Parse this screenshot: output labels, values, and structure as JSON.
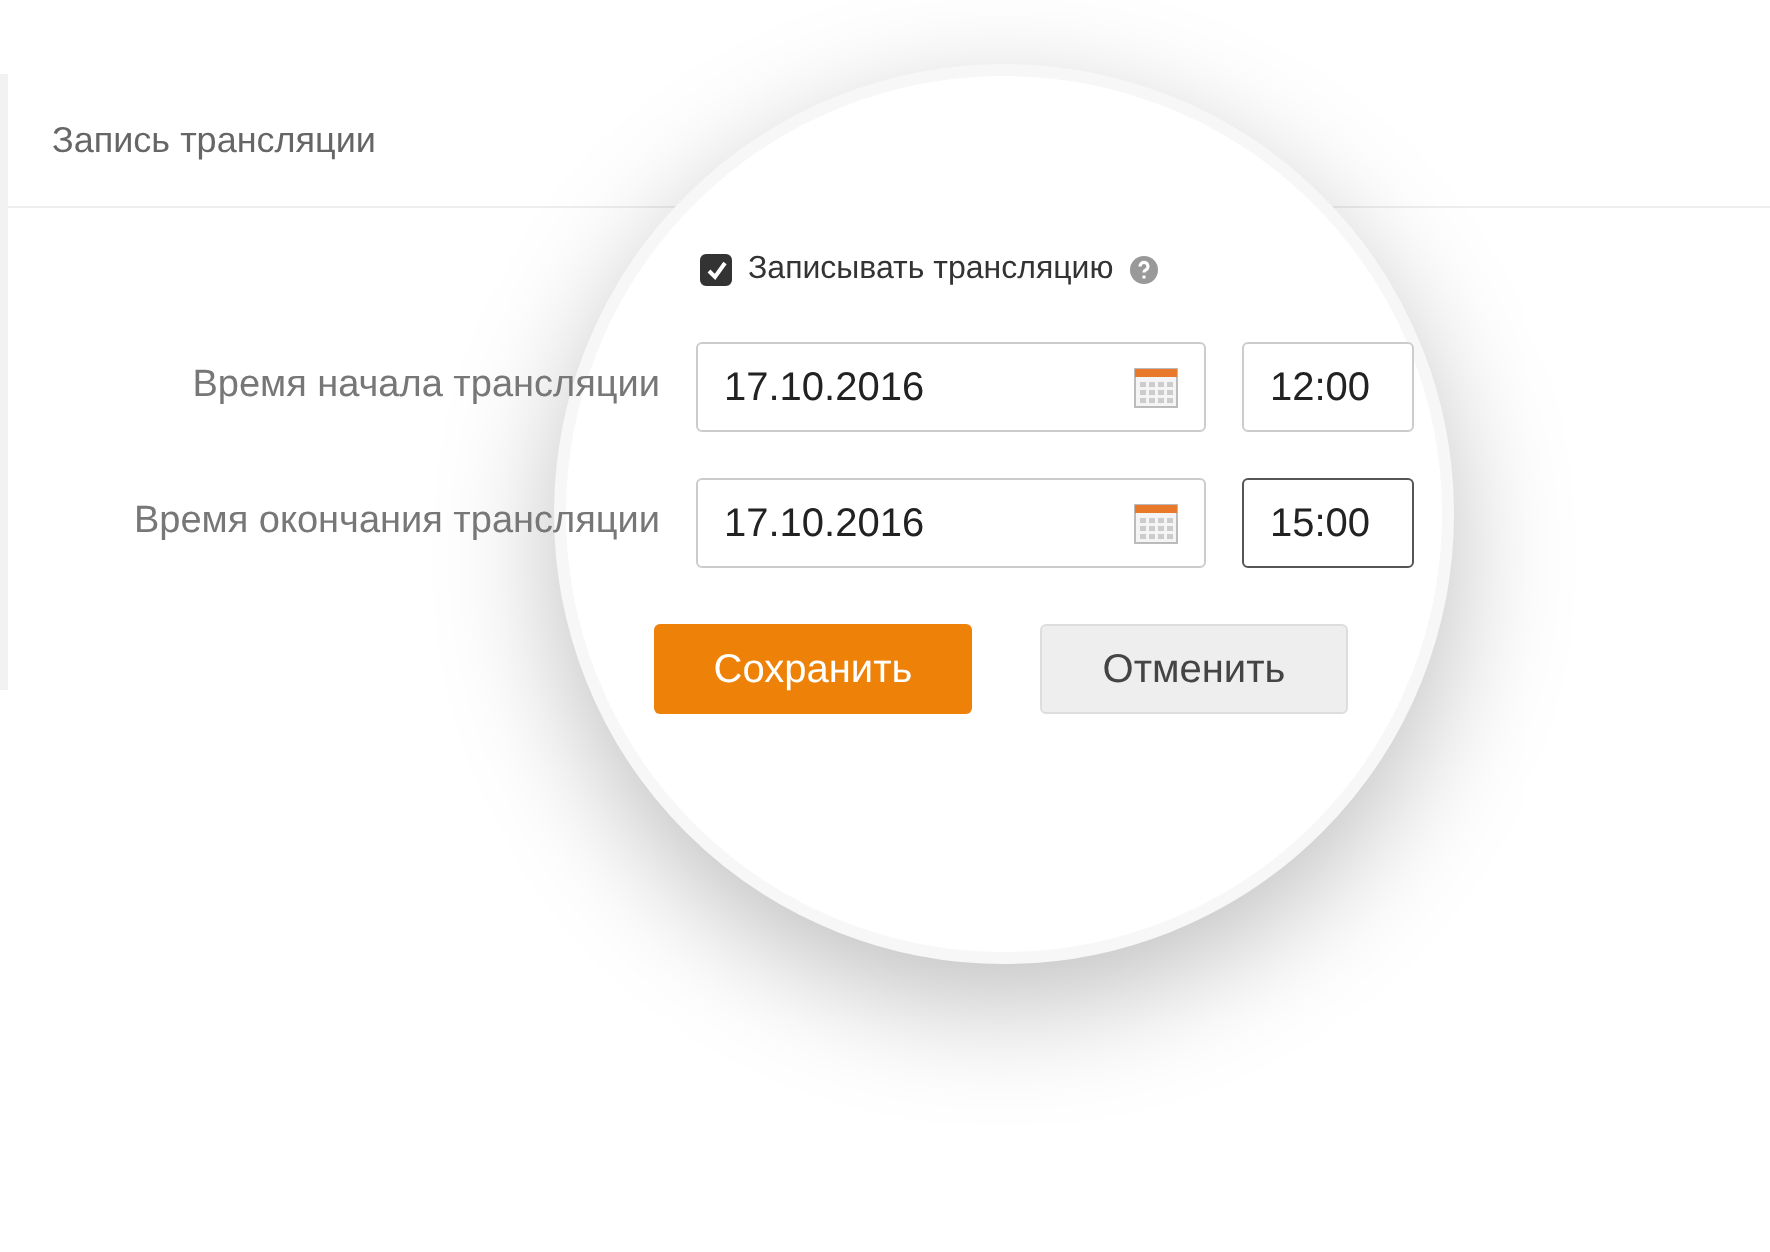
{
  "section": {
    "title": "Запись трансляции"
  },
  "record": {
    "label": "Записывать трансляцию",
    "checked": true
  },
  "rows": [
    {
      "label": "Время начала трансляции",
      "date": "17.10.2016",
      "time": "12:00",
      "focused": false
    },
    {
      "label": "Время окончания трансляции",
      "date": "17.10.2016",
      "time": "15:00",
      "focused": true
    }
  ],
  "buttons": [
    {
      "label": "Сохранить",
      "kind": "primary"
    },
    {
      "label": "Отменить",
      "kind": "secondary"
    }
  ]
}
